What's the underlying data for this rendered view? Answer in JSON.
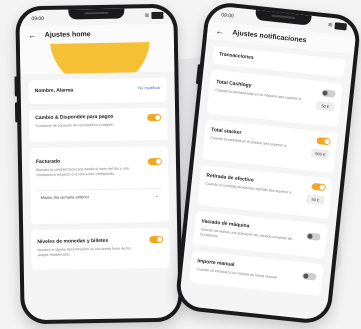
{
  "phone1": {
    "status_time": "09:00",
    "back_icon": "arrow-left-icon",
    "title": "Ajustes home",
    "name_label": "Nombre, Alarma",
    "name_link": "No modificar",
    "card_cambio": {
      "label": "Cambio & Disponible para pagos",
      "desc": "Sumatorio de consumo de recicladores y happen"
    },
    "card_facturado": {
      "label": "Facturado",
      "desc": "Muestra la cantidad facturada desde el inicio del día y una comparativa respecto a la referencia configurada.",
      "select_value": "Mismo día semana anterior"
    },
    "card_niveles": {
      "label": "Niveles de monedas y billetes",
      "desc": "Muestra si alguna denominación se encuentra fuera de los rangos establecidos."
    }
  },
  "phone2": {
    "status_time": "09:00",
    "title": "Ajustes notificaciones",
    "section": "Transacciones",
    "items": [
      {
        "label": "Total Cashlogy",
        "desc": "Cuando la cantidad total en la máquina sea superior a",
        "amount": "50 €"
      },
      {
        "label": "Total stacker",
        "desc": "Cuando la cantidad en el stacker sea superior a",
        "amount": "500 €"
      },
      {
        "label": "Retirada de efectivo",
        "desc": "Cuando la cantidad de efectivo retirado sea superior a",
        "amount": "50 €"
      },
      {
        "label": "Vaciado de máquina",
        "desc": "Cuando se realice una operación de vaciado completo de la máquina"
      },
      {
        "label": "Importe manual",
        "desc": "Cuando se introduzca un importe de forma manual"
      }
    ]
  }
}
